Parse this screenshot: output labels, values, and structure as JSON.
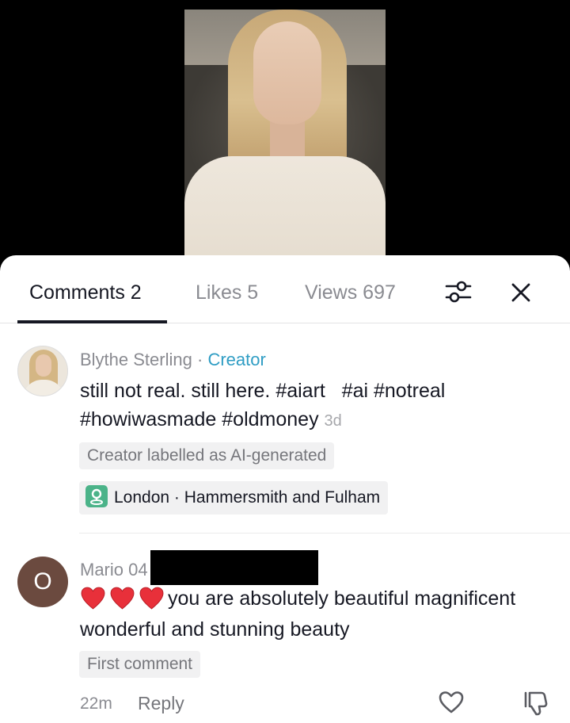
{
  "tabs": {
    "comments": "Comments 2",
    "likes": "Likes 5",
    "views": "Views 697",
    "active": "comments"
  },
  "icons": {
    "filter": "filter-sliders-icon",
    "close": "close-icon",
    "location": "location-pin-icon",
    "like": "heart-outline-icon",
    "dislike": "thumbs-down-icon"
  },
  "comments": [
    {
      "author": "Blythe Sterling",
      "separator": "·",
      "role": "Creator",
      "text": "still not real. still here. #aiart   #ai #notreal #howiwasmade #oldmoney",
      "time": "3d",
      "label": "Creator labelled as AI-generated",
      "location": "London · Hammersmith and Fulham"
    },
    {
      "avatar_letter": "O",
      "author": "Mario 04",
      "text": "you are absolutely beautiful magnificent wonderful and stunning beauty",
      "label": "First comment",
      "time": "22m",
      "reply": "Reply"
    }
  ],
  "colors": {
    "creator": "#2f9dc4",
    "heart": "#e8303a",
    "location_icon": "#4bb389",
    "avatar2": "#6b4a3f"
  }
}
